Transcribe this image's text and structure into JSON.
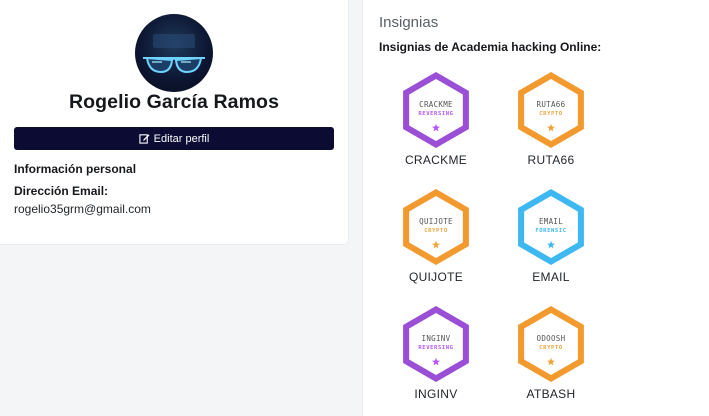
{
  "profile": {
    "name": "Rogelio García Ramos",
    "edit_button_label": "Editar perfil",
    "section_title": "Información personal",
    "email_label": "Dirección Email:",
    "email_value": "rogelio35grm@gmail.com"
  },
  "badges_panel": {
    "title": "Insignias",
    "subtitle": "Insignias de Academia hacking Online:",
    "badges": [
      {
        "name": "CRACKME",
        "hex_title": "CRACKME",
        "hex_category": "REVERSING",
        "color": "#9b4fd6",
        "accent": "#b455ff"
      },
      {
        "name": "RUTA66",
        "hex_title": "RUTA66",
        "hex_category": "CRYPTO",
        "color": "#f29a2e",
        "accent": "#f2a43a"
      },
      {
        "name": "QUIJOTE",
        "hex_title": "QUIJOTE",
        "hex_category": "CRYPTO",
        "color": "#f29a2e",
        "accent": "#f2a43a"
      },
      {
        "name": "EMAIL",
        "hex_title": "EMAIL",
        "hex_category": "FORENSIC",
        "color": "#3db8f0",
        "accent": "#3db8f0"
      },
      {
        "name": "INGINV",
        "hex_title": "INGINV",
        "hex_category": "REVERSING",
        "color": "#9b4fd6",
        "accent": "#b455ff"
      },
      {
        "name": "ATBASH",
        "hex_title": "ODOOSH",
        "hex_category": "CRYPTO",
        "color": "#f29a2e",
        "accent": "#f2a43a"
      }
    ]
  }
}
